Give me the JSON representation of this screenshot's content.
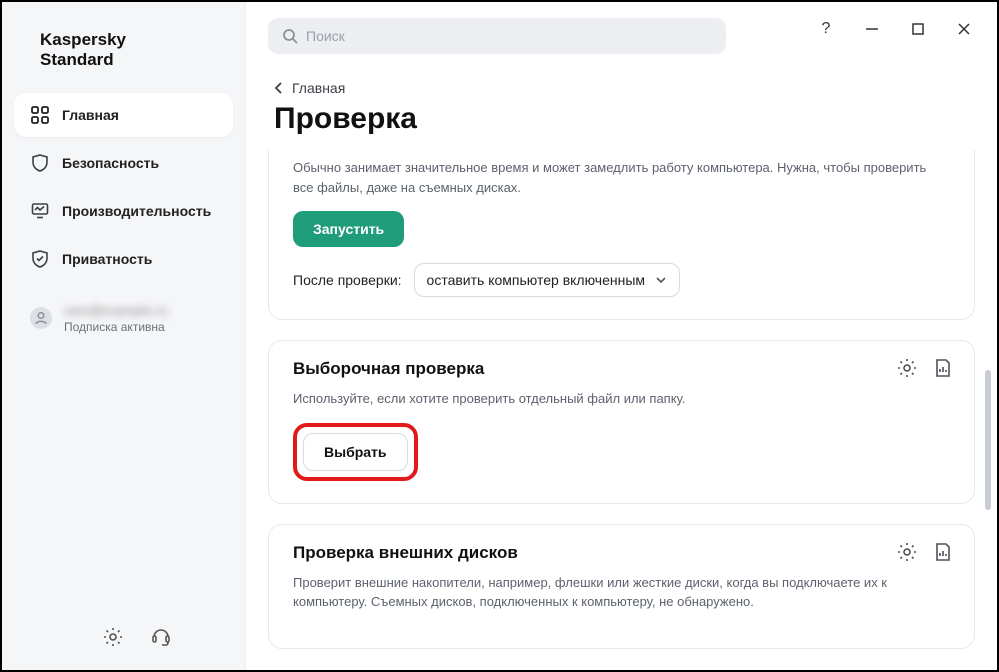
{
  "brand": {
    "line1": "Kaspersky",
    "line2": "Standard"
  },
  "titlebar": {
    "help": "?"
  },
  "search": {
    "placeholder": "Поиск"
  },
  "sidebar": {
    "items": [
      {
        "label": "Главная"
      },
      {
        "label": "Безопасность"
      },
      {
        "label": "Производительность"
      },
      {
        "label": "Приватность"
      }
    ],
    "account": {
      "masked": "user@example.ru",
      "sub": "Подписка активна"
    }
  },
  "breadcrumb": {
    "label": "Главная"
  },
  "page": {
    "title": "Проверка"
  },
  "fullscan": {
    "desc": "Обычно занимает значительное время и может замедлить работу компьютера. Нужна, чтобы проверить все файлы, даже на съемных дисках.",
    "run": "Запустить",
    "after_label": "После проверки:",
    "after_value": "оставить компьютер включенным"
  },
  "selective": {
    "title": "Выборочная проверка",
    "desc": "Используйте, если хотите проверить отдельный файл или папку.",
    "choose": "Выбрать"
  },
  "external": {
    "title": "Проверка внешних дисков",
    "desc": "Проверит внешние накопители, например, флешки или жесткие диски, когда вы подключаете их к компьютеру. Съемных дисков, подключенных к компьютеру, не обнаружено."
  }
}
